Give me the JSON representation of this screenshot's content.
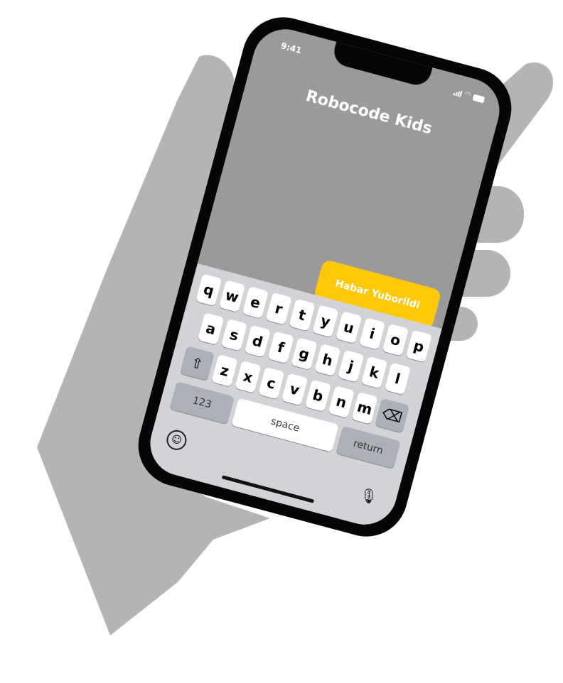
{
  "status_bar": {
    "time": "9:41"
  },
  "app": {
    "title": "Robocode Kids"
  },
  "message": {
    "text": "Habar Yuborildi",
    "send_icon": "arrow-up-icon"
  },
  "keyboard": {
    "row1": [
      "q",
      "w",
      "e",
      "r",
      "t",
      "y",
      "u",
      "i",
      "o",
      "p"
    ],
    "row2": [
      "a",
      "s",
      "d",
      "f",
      "g",
      "h",
      "j",
      "k",
      "l"
    ],
    "row3": [
      "z",
      "x",
      "c",
      "v",
      "b",
      "n",
      "m"
    ],
    "numbers_label": "123",
    "space_label": "space",
    "return_label": "return"
  },
  "colors": {
    "accent": "#ffc809",
    "screen": "#9a9a9a",
    "hand": "#b4b4b4",
    "keyboard": "#d1d3d9"
  }
}
